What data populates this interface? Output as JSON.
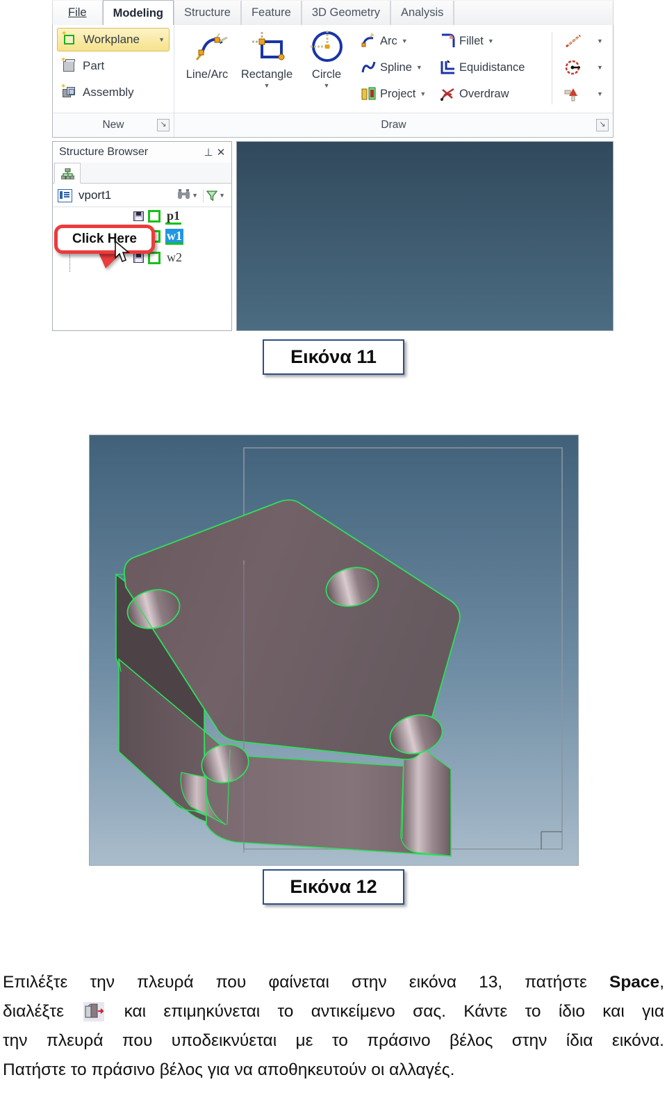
{
  "app": {
    "ribbon": {
      "tabs": [
        {
          "label": "File",
          "active": false,
          "is_file": true
        },
        {
          "label": "Modeling",
          "active": true,
          "is_file": false
        },
        {
          "label": "Structure",
          "active": false,
          "is_file": false
        },
        {
          "label": "Feature",
          "active": false,
          "is_file": false
        },
        {
          "label": "3D Geometry",
          "active": false,
          "is_file": false
        },
        {
          "label": "Analysis",
          "active": false,
          "is_file": false
        }
      ],
      "groups": [
        {
          "title": "New",
          "items": [
            {
              "label": "Workplane",
              "icon": "workplane-icon",
              "selected": true,
              "has_caret": true
            },
            {
              "label": "Part",
              "icon": "part-cube-icon",
              "selected": false,
              "has_caret": false
            },
            {
              "label": "Assembly",
              "icon": "assembly-icon",
              "selected": false,
              "has_caret": false
            }
          ]
        },
        {
          "title": "Draw",
          "big_items": [
            {
              "label": "Line/Arc",
              "icon": "line-arc-icon",
              "has_caret": false
            },
            {
              "label": "Rectangle",
              "icon": "rectangle-icon",
              "has_caret": true
            },
            {
              "label": "Circle",
              "icon": "circle-icon",
              "has_caret": true
            }
          ],
          "small_items": [
            {
              "label": "Arc",
              "icon": "arc-icon",
              "has_caret": true
            },
            {
              "label": "Spline",
              "icon": "spline-icon",
              "has_caret": true
            },
            {
              "label": "Project",
              "icon": "project-icon",
              "has_caret": true
            },
            {
              "label": "Fillet",
              "icon": "fillet-icon",
              "has_caret": true
            },
            {
              "label": "Equidistance",
              "icon": "equidistance-icon",
              "has_caret": false
            },
            {
              "label": "Overdraw",
              "icon": "overdraw-icon",
              "has_caret": false
            }
          ],
          "gallery_items": [
            {
              "icon": "construction-line-icon",
              "has_caret": true
            },
            {
              "icon": "construction-circle-icon",
              "has_caret": true
            },
            {
              "icon": "point-marker-icon",
              "has_caret": true
            }
          ]
        }
      ]
    },
    "structure_browser": {
      "title": "Structure Browser",
      "pin_icon": "pin-icon",
      "close_icon": "close-icon",
      "tab_icon": "tree-structure-icon",
      "toolbar": {
        "vport_label": "vport1",
        "vport_icon": "viewport-icon",
        "find_icon": "binoculars-icon",
        "filter_icon": "funnel-icon"
      },
      "tree_nodes": [
        {
          "label": "p1",
          "state": "underlined",
          "icons": [
            "save-icon",
            "visibility-checkbox"
          ]
        },
        {
          "label": "w1",
          "state": "selected",
          "icons": [
            "save-icon",
            "visibility-checkbox"
          ]
        },
        {
          "label": "w2",
          "state": "normal",
          "icons": [
            "save-icon",
            "visibility-checkbox"
          ]
        }
      ],
      "callout": {
        "text": "Click Here",
        "color": "#ec3b3b"
      }
    },
    "viewport": {
      "background_top": "#31495c",
      "background_bottom": "#4b6c82"
    }
  },
  "captions": {
    "figure_11": "Εικόνα 11",
    "figure_12": "Εικόνα 12"
  },
  "model_view": {
    "background_top": "#41617a",
    "background_bottom": "#a9bccb",
    "edge_color": "#2ee05a",
    "face_color": "#6e5f63",
    "workplane_outline_color": "#7d8794",
    "description": "Rounded rectangular plate with four through holes, green highlighted edges"
  },
  "body_text": {
    "line1_part1": "Επιλέξτε την πλευρά που φαίνεται στην εικόνα 13, πατήστε ",
    "line1_bold": "Space",
    "line1_part2": ",",
    "line2_part1": "διαλέξτε ",
    "line2_icon": "extrude-icon",
    "line2_part2": " και επιμηκύνεται το αντικείμενο σας. Κάντε το ίδιο και για",
    "line3": "την πλευρά που υποδεικνύεται με το πράσινο βέλος στην ίδια εικόνα.",
    "line4": "Πατήστε το πράσινο βέλος για να αποθηκευτούν οι αλλαγές."
  }
}
